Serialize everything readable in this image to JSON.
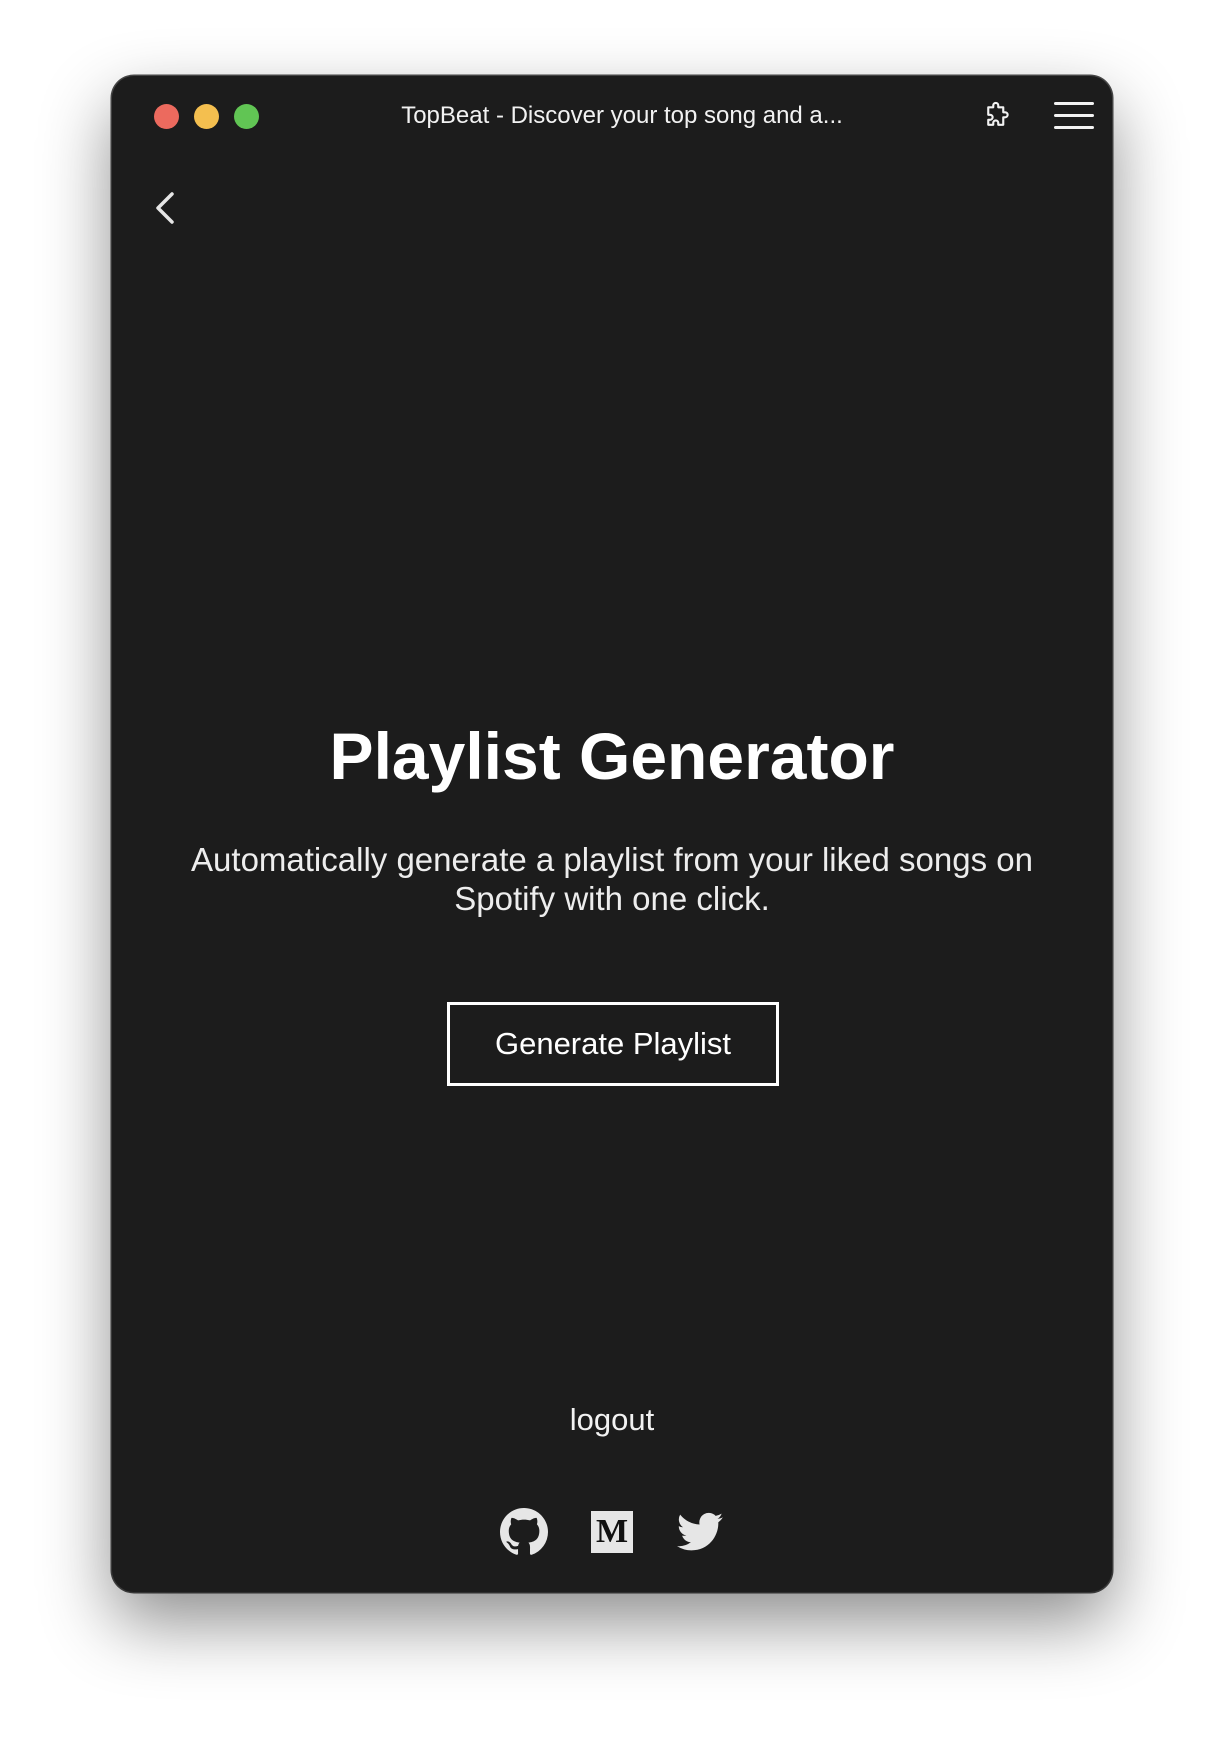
{
  "window": {
    "title": "TopBeat - Discover your top song and a..."
  },
  "titlebar": {
    "traffic_lights": [
      {
        "name": "close",
        "color": "#ec6a5e"
      },
      {
        "name": "minimize",
        "color": "#f4bf4f"
      },
      {
        "name": "zoom",
        "color": "#61c554"
      }
    ],
    "right_icons": [
      "extension-puzzle-icon",
      "hamburger-menu-icon"
    ]
  },
  "nav": {
    "back_icon": "chevron-left-icon"
  },
  "main": {
    "title": "Playlist Generator",
    "subtitle": "Automatically generate a playlist from your liked songs on Spotify with one click.",
    "generate_button_label": "Generate Playlist"
  },
  "footer": {
    "logout_label": "logout",
    "social_links": [
      {
        "name": "github",
        "icon": "github-icon"
      },
      {
        "name": "medium",
        "icon": "medium-icon",
        "glyph": "M"
      },
      {
        "name": "twitter",
        "icon": "twitter-icon"
      }
    ]
  },
  "colors": {
    "background": "#1c1c1c",
    "text": "#ffffff"
  }
}
